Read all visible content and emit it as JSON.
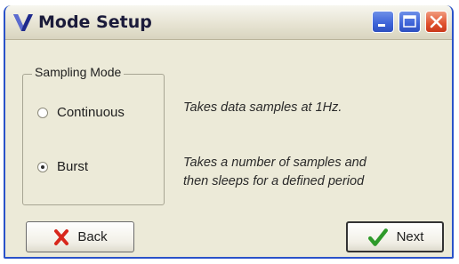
{
  "window": {
    "title": "Mode Setup",
    "icon": "v-logo-icon",
    "controls": [
      "minimize-icon",
      "maximize-icon",
      "close-icon"
    ]
  },
  "sampling_mode": {
    "legend": "Sampling Mode",
    "options": [
      {
        "label": "Continuous",
        "checked": false,
        "description": "Takes data samples at 1Hz."
      },
      {
        "label": "Burst",
        "checked": true,
        "description_lines": [
          "Takes a number of samples and",
          "then sleeps for a defined period"
        ]
      }
    ]
  },
  "buttons": {
    "back": {
      "label": "Back",
      "icon": "red-x-icon"
    },
    "next": {
      "label": "Next",
      "icon": "green-check-icon"
    }
  },
  "colors": {
    "title_accent": "#2a52c9",
    "close_button": "#e0522e",
    "back_x": "#d8271c",
    "next_check": "#2e9a2a"
  }
}
